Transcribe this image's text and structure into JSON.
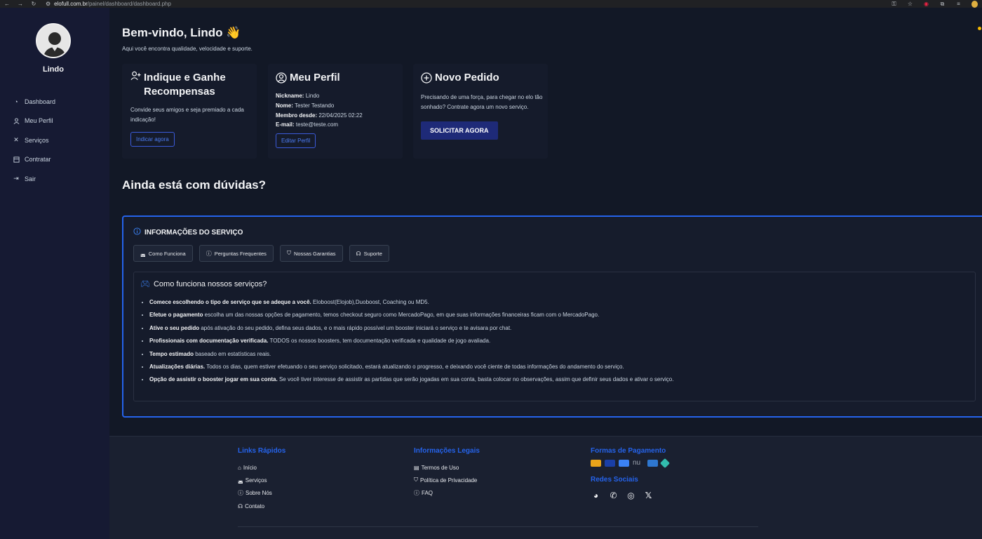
{
  "browser": {
    "domain": "elofull.com.br",
    "path": "/painel/dashboard/dashboard.php"
  },
  "sidebar": {
    "username": "Lindo",
    "items": [
      {
        "label": "Dashboard",
        "icon": "dashboard-icon"
      },
      {
        "label": "Meu Perfil",
        "icon": "user-icon"
      },
      {
        "label": "Serviços",
        "icon": "tools-icon"
      },
      {
        "label": "Contratar",
        "icon": "store-icon"
      },
      {
        "label": "Sair",
        "icon": "logout-icon"
      }
    ]
  },
  "main": {
    "welcome": "Bem-vindo, Lindo 👋",
    "subtitle": "Aqui você encontra qualidade, velocidade e suporte.",
    "cards": {
      "referral": {
        "title": "Indique e Ganhe Recompensas",
        "text": "Convide seus amigos e seja premiado a cada indicação!",
        "button": "Indicar agora"
      },
      "profile": {
        "title": "Meu Perfil",
        "fields": [
          {
            "label": "Nickname:",
            "value": "Lindo"
          },
          {
            "label": "Nome:",
            "value": "Tester Testando"
          },
          {
            "label": "Membro desde:",
            "value": "22/04/2025 02:22"
          },
          {
            "label": "E-mail:",
            "value": "teste@teste.com"
          }
        ],
        "button": "Editar Perfil"
      },
      "order": {
        "title": "Novo Pedido",
        "text": "Precisando de uma força, para chegar no elo tão sonhado? Contrate agora um novo serviço.",
        "button": "SOLICITAR AGORA"
      }
    },
    "doubts_title": "Ainda está com dúvidas?",
    "info": {
      "title": "INFORMAÇÕES DO SERVIÇO",
      "tabs": [
        {
          "label": "Como Funciona",
          "icon": "gamepad-icon"
        },
        {
          "label": "Perguntas Frequentes",
          "icon": "question-icon"
        },
        {
          "label": "Nossas Garantias",
          "icon": "shield-icon"
        },
        {
          "label": "Suporte",
          "icon": "headset-icon"
        }
      ],
      "panel_title": "Como funciona nossos serviços?",
      "items": [
        {
          "bold": "Comece escolhendo o tipo de serviço que se adeque a você.",
          "text": " Eloboost(Elojob),Duoboost, Coaching ou MD5."
        },
        {
          "bold": "Efetue o pagamento",
          "text": " escolha um das nossas opções de pagamento, temos checkout seguro como MercadoPago, em que suas informações financeiras ficam com o MercadoPago."
        },
        {
          "bold": "Ative o seu pedido",
          "text": " após ativação do seu pedido, defina seus dados, e o mais rápido possível um booster iniciará o serviço e te avisara por chat."
        },
        {
          "bold": "Profissionais com documentação verificada.",
          "text": " TODOS os nossos boosters, tem documentação verificada e qualidade de jogo avaliada."
        },
        {
          "bold": "Tempo estimado",
          "text": " baseado em estatísticas reais."
        },
        {
          "bold": "Atualizações diárias.",
          "text": " Todos os dias, quem estiver efetuando o seu serviço solicitado, estará atualizando o progresso, e deixando você ciente de todas informações do andamento do serviço."
        },
        {
          "bold": "Opção de assistir o booster jogar em sua conta.",
          "text": " Se você tiver interesse de assistir as partidas que serão jogadas em sua conta, basta colocar no observações, assim que definir seus dados e ativar o serviço."
        }
      ]
    }
  },
  "footer": {
    "quick_links": {
      "title": "Links Rápidos",
      "links": [
        {
          "label": "Início",
          "icon": "home-icon"
        },
        {
          "label": "Serviços",
          "icon": "gamepad-icon"
        },
        {
          "label": "Sobre Nós",
          "icon": "info-icon"
        },
        {
          "label": "Contato",
          "icon": "headset-icon"
        }
      ]
    },
    "legal": {
      "title": "Informações Legais",
      "links": [
        {
          "label": "Termos de Uso",
          "icon": "document-icon"
        },
        {
          "label": "Política de Privacidade",
          "icon": "shield-icon"
        },
        {
          "label": "FAQ",
          "icon": "question-icon"
        }
      ]
    },
    "payment": {
      "title": "Formas de Pagamento",
      "methods": [
        {
          "icon": "mastercard-icon",
          "color": "#e8a31a"
        },
        {
          "icon": "visa-icon",
          "color": "#1a3fa6"
        },
        {
          "icon": "boleto-icon",
          "color": "#3b82f6"
        },
        {
          "icon": "nubank-icon",
          "color": "#1a2030"
        },
        {
          "icon": "amex-icon",
          "color": "#2e77d0"
        },
        {
          "icon": "pix-icon",
          "color": "#32bcad"
        }
      ]
    },
    "social": {
      "title": "Redes Sociais",
      "icons": [
        "discord-icon",
        "whatsapp-icon",
        "instagram-icon",
        "x-icon"
      ]
    }
  },
  "colors": {
    "accent": "#2563eb",
    "sidebar": "#161a33",
    "background": "#121826"
  }
}
